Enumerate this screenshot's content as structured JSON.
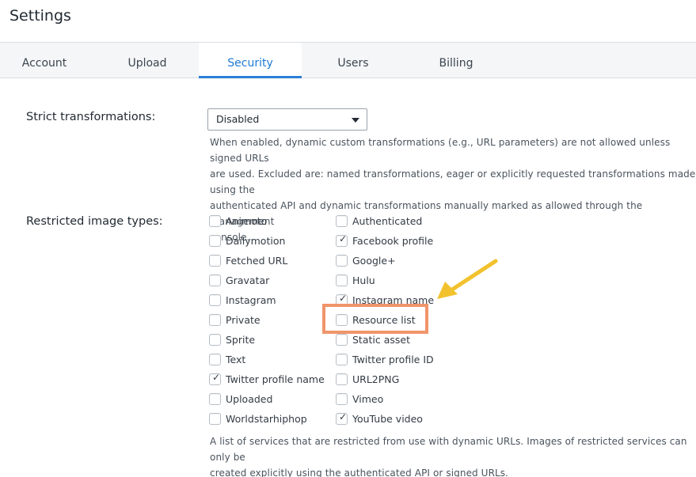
{
  "header": {
    "title": "Settings"
  },
  "tabs": [
    {
      "label": "Account"
    },
    {
      "label": "Upload"
    },
    {
      "label": "Security"
    },
    {
      "label": "Users"
    },
    {
      "label": "Billing"
    }
  ],
  "active_tab": "Security",
  "strict": {
    "label": "Strict transformations:",
    "select_value": "Disabled",
    "desc_lines": [
      "When enabled, dynamic custom transformations (e.g., URL parameters) are not allowed unless signed URLs",
      "are used. Excluded are: named transformations, eager or explicitly requested transformations made using the",
      "authenticated API and dynamic transformations manually marked as allowed through the management",
      "console."
    ]
  },
  "restricted": {
    "label": "Restricted image types:",
    "col1": [
      {
        "label": "Animoto",
        "checked": false
      },
      {
        "label": "Dailymotion",
        "checked": false
      },
      {
        "label": "Fetched URL",
        "checked": false
      },
      {
        "label": "Gravatar",
        "checked": false
      },
      {
        "label": "Instagram",
        "checked": false
      },
      {
        "label": "Private",
        "checked": false
      },
      {
        "label": "Sprite",
        "checked": false
      },
      {
        "label": "Text",
        "checked": false
      },
      {
        "label": "Twitter profile name",
        "checked": true
      },
      {
        "label": "Uploaded",
        "checked": false
      },
      {
        "label": "Worldstarhiphop",
        "checked": false
      }
    ],
    "col2": [
      {
        "label": "Authenticated",
        "checked": false
      },
      {
        "label": "Facebook profile",
        "checked": true
      },
      {
        "label": "Google+",
        "checked": false
      },
      {
        "label": "Hulu",
        "checked": false
      },
      {
        "label": "Instagram name",
        "checked": true
      },
      {
        "label": "Resource list",
        "checked": false
      },
      {
        "label": "Static asset",
        "checked": false
      },
      {
        "label": "Twitter profile ID",
        "checked": false
      },
      {
        "label": "URL2PNG",
        "checked": false
      },
      {
        "label": "Vimeo",
        "checked": false
      },
      {
        "label": "YouTube video",
        "checked": true
      }
    ],
    "desc_lines": [
      "A list of services that are restricted from use with dynamic URLs. Images of restricted services can only be",
      "created explicitly using the authenticated API or signed URLs."
    ]
  },
  "colors": {
    "accent": "#2b7fd8",
    "highlight": "#f0956a",
    "arrow": "#f2c22e"
  },
  "icons": {
    "check": "✓",
    "caret": "chevron-down-icon",
    "annotation": "arrow-icon"
  }
}
